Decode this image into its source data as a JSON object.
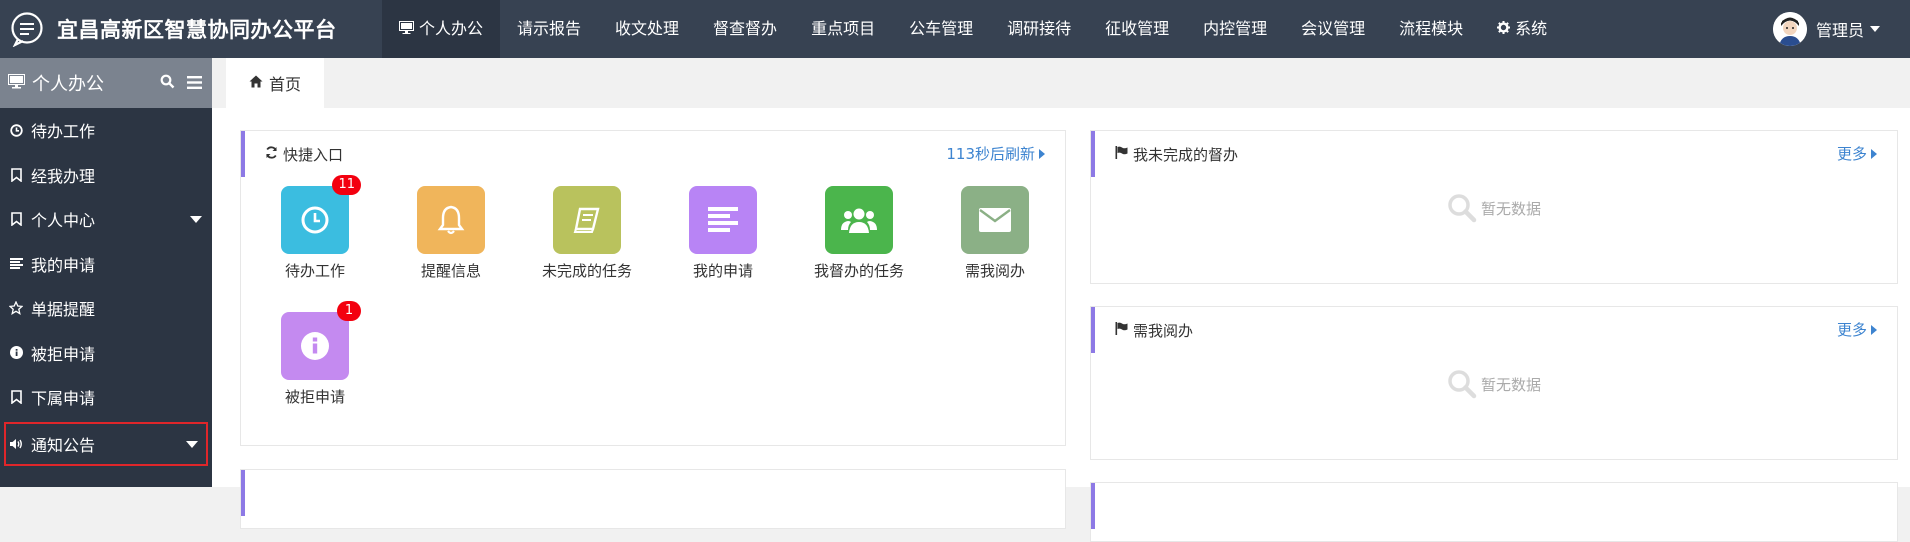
{
  "app": {
    "title": "宜昌高新区智慧协同办公平台"
  },
  "topnav": [
    {
      "label": "个人办公",
      "icon": "monitor-icon",
      "active": true
    },
    {
      "label": "请示报告"
    },
    {
      "label": "收文处理"
    },
    {
      "label": "督查督办"
    },
    {
      "label": "重点项目"
    },
    {
      "label": "公车管理"
    },
    {
      "label": "调研接待"
    },
    {
      "label": "征收管理"
    },
    {
      "label": "内控管理"
    },
    {
      "label": "会议管理"
    },
    {
      "label": "流程模块"
    },
    {
      "label": "系统",
      "icon": "gear-icon"
    }
  ],
  "user": {
    "name": "管理员"
  },
  "sidebar": {
    "title": "个人办公",
    "items": [
      {
        "label": "待办工作",
        "icon": "clock-icon"
      },
      {
        "label": "经我办理",
        "icon": "bookmark-icon"
      },
      {
        "label": "个人中心",
        "icon": "bookmark-icon",
        "has_children": true
      },
      {
        "label": "我的申请",
        "icon": "list-icon"
      },
      {
        "label": "单据提醒",
        "icon": "star-icon"
      },
      {
        "label": "被拒申请",
        "icon": "info-icon"
      },
      {
        "label": "下属申请",
        "icon": "bookmark-icon"
      },
      {
        "label": "通知公告",
        "icon": "speaker-icon",
        "has_children": true,
        "highlighted": true
      }
    ]
  },
  "tab": {
    "label": "首页"
  },
  "quick_panel": {
    "title": "快捷入口",
    "refresh_text": "113秒后刷新",
    "tiles": [
      {
        "label": "待办工作",
        "icon": "clock-icon",
        "color": "#3bbde0",
        "badge": "11"
      },
      {
        "label": "提醒信息",
        "icon": "bell-icon",
        "color": "#f0b55b"
      },
      {
        "label": "未完成的任务",
        "icon": "book-icon",
        "color": "#b9c25d"
      },
      {
        "label": "我的申请",
        "icon": "list-icon",
        "color": "#b884f5"
      },
      {
        "label": "我督办的任务",
        "icon": "users-icon",
        "color": "#4bb54c"
      },
      {
        "label": "需我阅办",
        "icon": "envelope-icon",
        "color": "#8bb086"
      },
      {
        "label": "被拒申请",
        "icon": "info-icon",
        "color": "#c48af0",
        "badge": "1"
      }
    ]
  },
  "panels": {
    "supervise": {
      "title": "我未完成的督办",
      "more": "更多",
      "empty": "暂无数据"
    },
    "read": {
      "title": "需我阅办",
      "more": "更多",
      "empty": "暂无数据"
    }
  },
  "colors": {
    "topbar": "#374252",
    "sidebar": "#2c3543",
    "accent": "#8d79e5",
    "link": "#3d84d0",
    "badge": "#f3000f",
    "highlight_border": "#e0262a"
  }
}
